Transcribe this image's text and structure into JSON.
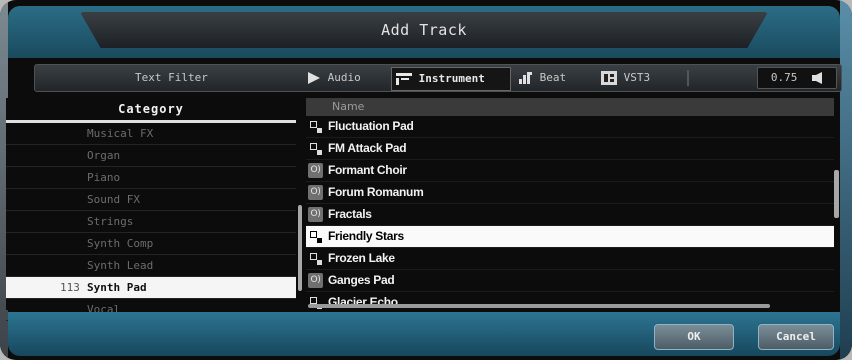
{
  "window": {
    "title": "Add Track"
  },
  "filterbar": {
    "text_filter": "Text Filter",
    "audio": "Audio",
    "instrument": "Instrument",
    "beat": "Beat",
    "vst3": "VST3",
    "volume": "0.75"
  },
  "category": {
    "header": "Category",
    "items": [
      {
        "label": "Musical FX"
      },
      {
        "label": "Organ"
      },
      {
        "label": "Piano"
      },
      {
        "label": "Sound FX"
      },
      {
        "label": "Strings"
      },
      {
        "label": "Synth Comp"
      },
      {
        "label": "Synth Lead"
      },
      {
        "label": "Synth Pad",
        "count": "113",
        "selected": true
      },
      {
        "label": "Vocal"
      }
    ]
  },
  "names": {
    "header": "Name",
    "items": [
      {
        "label": "Fluctuation Pad",
        "icon": "instrument-icon"
      },
      {
        "label": "FM Attack Pad",
        "icon": "instrument-icon"
      },
      {
        "label": "Formant Choir",
        "icon": "audio-icon"
      },
      {
        "label": "Forum Romanum",
        "icon": "audio-icon"
      },
      {
        "label": "Fractals",
        "icon": "audio-icon"
      },
      {
        "label": "Friendly Stars",
        "icon": "instrument-icon",
        "selected": true
      },
      {
        "label": "Frozen Lake",
        "icon": "instrument-icon"
      },
      {
        "label": "Ganges Pad",
        "icon": "audio-icon"
      },
      {
        "label": "Glacier Echo",
        "icon": "instrument-icon"
      }
    ]
  },
  "footer": {
    "ok": "OK",
    "cancel": "Cancel"
  },
  "colors": {
    "accent": "#2b6d86",
    "selection": "#fafafa",
    "background": "#0c0c0c"
  }
}
